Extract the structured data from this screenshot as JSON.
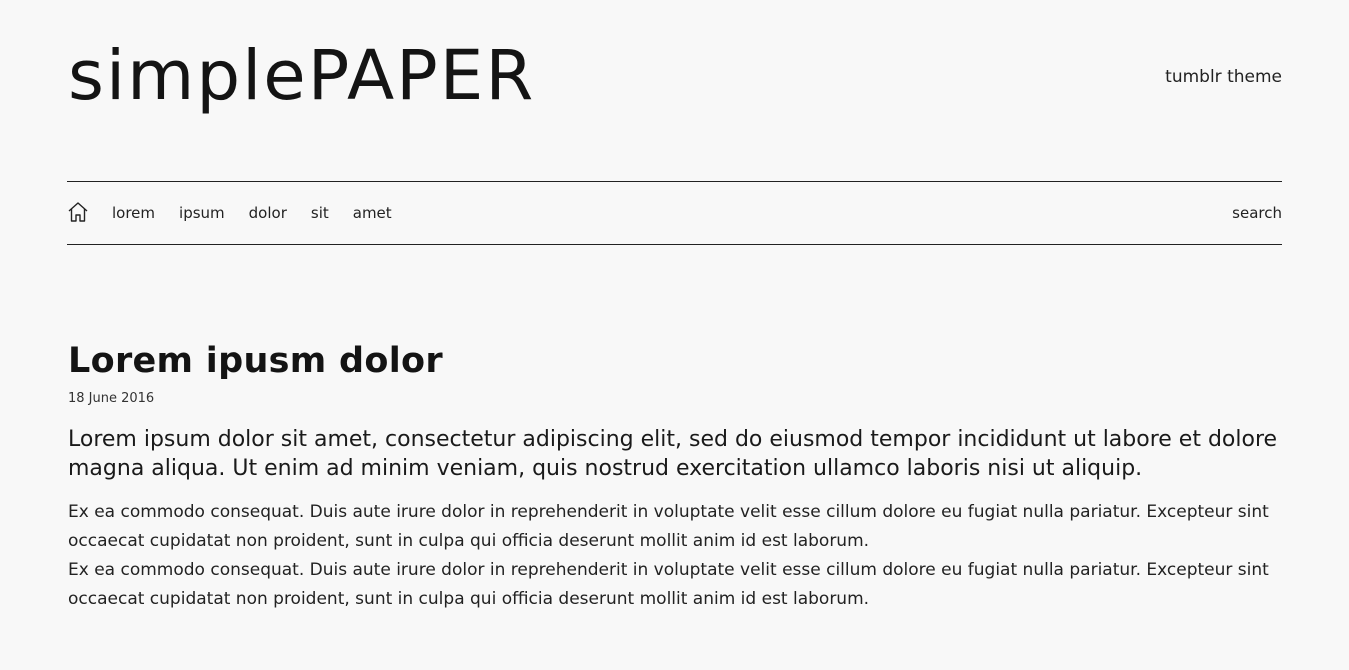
{
  "header": {
    "logo_text": "simplePAPER",
    "tagline": "tumblr theme"
  },
  "nav": {
    "home_icon": "home-icon",
    "links": [
      "lorem",
      "ipsum",
      "dolor",
      "sit",
      "amet"
    ],
    "search_label": "search"
  },
  "post": {
    "title": "Lorem ipusm dolor",
    "date": "18 June 2016",
    "lead": "Lorem ipsum dolor sit amet, consectetur adipiscing elit, sed do eiusmod tempor incididunt ut labore et dolore magna aliqua. Ut enim ad minim veniam, quis nostrud exercitation ullamco laboris nisi ut aliquip.",
    "paragraphs": [
      "Ex ea commodo consequat. Duis aute irure dolor in reprehenderit in voluptate velit esse cillum dolore eu fugiat nulla pariatur. Excepteur sint occaecat cupidatat non proident, sunt in culpa qui officia deserunt mollit anim id est laborum.",
      "Ex ea commodo consequat. Duis aute irure dolor in reprehenderit in voluptate velit esse cillum dolore eu fugiat nulla pariatur. Excepteur sint occaecat cupidatat non proident, sunt in culpa qui officia deserunt mollit anim id est laborum."
    ]
  },
  "colors": {
    "background": "#f8f8f8",
    "text": "#1a1a1a",
    "rule": "#222222"
  }
}
